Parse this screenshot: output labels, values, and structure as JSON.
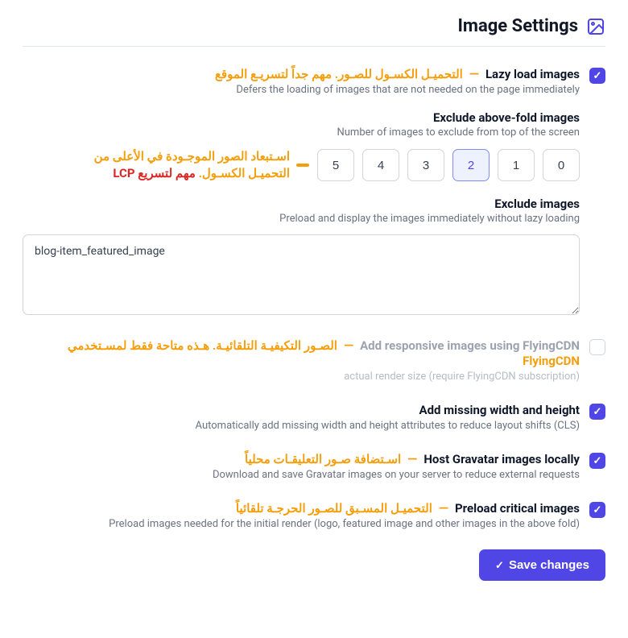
{
  "header": {
    "title": "Image Settings"
  },
  "settings": {
    "lazy": {
      "label": "Lazy load images",
      "annot": "التحميـل الكسـول للصـور. مهم جداً لتسريـع الموقع",
      "desc": "Defers the loading of images that are not needed on the page immediately"
    },
    "excludeAbove": {
      "label": "Exclude above-fold images",
      "desc": "Number of images to exclude from top of the screen",
      "options": [
        "0",
        "1",
        "2",
        "3",
        "4",
        "5"
      ],
      "selected": "2",
      "annot_line1": "اسـتبعاد الصور الموجـودة في الأعلى من",
      "annot_line2_a": "التحميـل الكسـول.",
      "annot_line2_b": "مهم لتسريع LCP"
    },
    "excludeImages": {
      "label": "Exclude images",
      "desc": "Preload and display the images immediately without lazy loading",
      "value": "blog-item_featured_image"
    },
    "responsive": {
      "label": "Add responsive images using FlyingCDN",
      "annot": "الصـور التكيفيـة التلقائيـة. هـذه متاحة فقط لمسـتخدمي FlyingCDN",
      "desc": "actual render size (require FlyingCDN subscription)"
    },
    "missingWH": {
      "label": "Add missing width and height",
      "desc": "Automatically add missing width and height attributes to reduce layout shifts (CLS)"
    },
    "gravatar": {
      "label": "Host Gravatar images locally",
      "annot": "اسـتضافة صـور التعليقـات محلياً",
      "desc": "Download and save Gravatar images on your server to reduce external requests"
    },
    "preload": {
      "label": "Preload critical images",
      "annot": "التحميـل المسـبق للصـور الحرجـة تلقائياً",
      "desc": "Preload images needed for the initial render (logo, featured image and other images in the above fold)"
    }
  },
  "actions": {
    "save": "Save changes"
  },
  "colors": {
    "accent": "#4f46e5",
    "annot": "#f59e0b",
    "red": "#dc2626"
  }
}
